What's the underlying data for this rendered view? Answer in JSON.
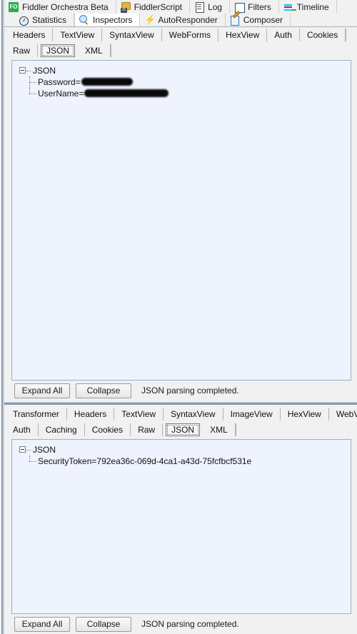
{
  "toolbar": {
    "row1": [
      {
        "label": "Fiddler Orchestra Beta",
        "icon": "fiddler-orchestra-icon",
        "active": false
      },
      {
        "label": "FiddlerScript",
        "icon": "fiddlerscript-icon",
        "active": false
      },
      {
        "label": "Log",
        "icon": "log-icon",
        "active": false
      },
      {
        "label": "Filters",
        "icon": "filters-icon",
        "active": false
      },
      {
        "label": "Timeline",
        "icon": "timeline-icon",
        "active": false
      }
    ],
    "row2": [
      {
        "label": "Statistics",
        "icon": "statistics-icon",
        "active": false
      },
      {
        "label": "Inspectors",
        "icon": "inspectors-icon",
        "active": true
      },
      {
        "label": "AutoResponder",
        "icon": "autoresponder-icon",
        "active": false
      },
      {
        "label": "Composer",
        "icon": "composer-icon",
        "active": false
      }
    ]
  },
  "request_panel": {
    "tabs_row1": [
      "Headers",
      "TextView",
      "SyntaxView",
      "WebForms",
      "HexView",
      "Auth",
      "Cookies"
    ],
    "tabs_row2": [
      "Raw",
      "JSON",
      "XML"
    ],
    "selected_tab": "JSON",
    "tree": {
      "root": "JSON",
      "children": [
        {
          "key": "Password",
          "separator": "=",
          "value": "",
          "redacted": true,
          "redaction_width": 72
        },
        {
          "key": "UserName",
          "separator": "=",
          "value": "",
          "redacted": true,
          "redaction_width": 118
        }
      ]
    },
    "expand_all_label": "Expand All",
    "collapse_label": "Collapse",
    "status": "JSON parsing completed."
  },
  "response_panel": {
    "tabs_row1": [
      "Transformer",
      "Headers",
      "TextView",
      "SyntaxView",
      "ImageView",
      "HexView",
      "WebView"
    ],
    "tabs_row2": [
      "Auth",
      "Caching",
      "Cookies",
      "Raw",
      "JSON",
      "XML"
    ],
    "selected_tab": "JSON",
    "tree": {
      "root": "JSON",
      "children": [
        {
          "key": "SecurityToken",
          "separator": "=",
          "value": "792ea36c-069d-4ca1-a43d-75fcfbcf531e",
          "redacted": false
        }
      ]
    },
    "expand_all_label": "Expand All",
    "collapse_label": "Collapse",
    "status": "JSON parsing completed."
  },
  "colors": {
    "toolbar_bg": "#f1f1f1",
    "content_bg": "#eef3fd",
    "border": "#9fb0c2",
    "accent_green": "#22b14c",
    "redaction": "#0a0a0a"
  }
}
